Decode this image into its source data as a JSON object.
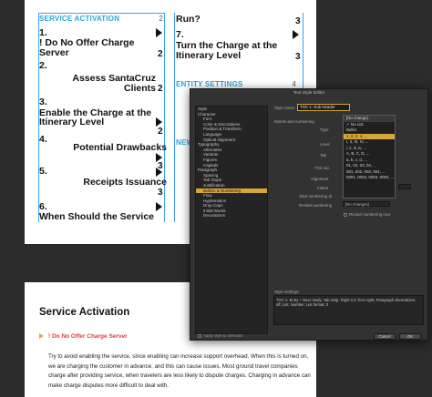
{
  "toc_left": {
    "heading": "SERVICE ACTIVATION",
    "heading_page": "2",
    "entries": [
      {
        "lines": [
          "1.",
          "! Do No Offer Charge",
          "Server"
        ],
        "page": "2"
      },
      {
        "lines": [
          "2.",
          "Assess SantaCruz Clients"
        ],
        "page": "2"
      },
      {
        "lines": [
          "3.",
          "Enable the Charge at the",
          "Itinerary Level"
        ],
        "page": "2"
      },
      {
        "lines": [
          "4.",
          "Potential Drawbacks"
        ],
        "page": "3"
      },
      {
        "lines": [
          "5.",
          "Receipts Issuance"
        ],
        "page": "3"
      },
      {
        "lines": [
          "6.",
          "When Should the Service"
        ],
        "page": "3"
      }
    ]
  },
  "toc_right": {
    "entry_a": [
      "Run?"
    ],
    "entry_a_page": "3",
    "entry_b": [
      "7.",
      "Turn the Charge at the",
      "Itinerary Level"
    ],
    "entry_b_page": "3",
    "heading": "ENTITY SETTINGS",
    "heading_page": "4",
    "heading2_partial": "NEW"
  },
  "dialog": {
    "title": "Text Style Editor",
    "style_name_label": "Style name:",
    "style_name_value": "TOC 1: Sub Header",
    "section_label": "Bullets and numbering",
    "type_label": "Type",
    "level_label": "Level",
    "tab_label": "Tab",
    "first_indent_label": "First ind.",
    "alignment_label": "Alignment",
    "indent_label": "Indent",
    "start_numbering_label": "Start numbering at",
    "restart_numbering_label": "Restart numbering",
    "no_changes_label": "[No changes]",
    "restart_list_label": "Restart numbering now",
    "sidebar": [
      {
        "label": "Style",
        "level": 0
      },
      {
        "label": "Character",
        "level": 0
      },
      {
        "label": "Font",
        "level": 1
      },
      {
        "label": "Color & Decorations",
        "level": 1
      },
      {
        "label": "Position & Transform",
        "level": 1
      },
      {
        "label": "Language",
        "level": 1
      },
      {
        "label": "Optical Alignment",
        "level": 1
      },
      {
        "label": "Typography",
        "level": 0
      },
      {
        "label": "Alternates",
        "level": 1
      },
      {
        "label": "Variants",
        "level": 1
      },
      {
        "label": "Figures",
        "level": 1
      },
      {
        "label": "Capitals",
        "level": 1
      },
      {
        "label": "Paragraph",
        "level": 0
      },
      {
        "label": "Spacing",
        "level": 1
      },
      {
        "label": "Tab Stops",
        "level": 1
      },
      {
        "label": "Justification",
        "level": 1
      },
      {
        "label": "Bullets & Numbering",
        "level": 1,
        "selected": true
      },
      {
        "label": "Flow",
        "level": 1
      },
      {
        "label": "Hyphenation",
        "level": 1
      },
      {
        "label": "Drop Caps",
        "level": 1
      },
      {
        "label": "Initial Words",
        "level": 1
      },
      {
        "label": "Decorations",
        "level": 1
      }
    ],
    "list_options": [
      {
        "label": "[No change]"
      },
      {
        "label": "✓ No List"
      },
      {
        "label": "Bullet"
      },
      {
        "label": "1, 2, 3, 4, ...",
        "selected": true
      },
      {
        "label": "I, II, III, IV, ..."
      },
      {
        "label": "i, ii, iii, iv, ..."
      },
      {
        "label": "A, B, C, D, ..."
      },
      {
        "label": "a, b, c, d, ..."
      },
      {
        "label": "01, 02, 03, 04, ..."
      },
      {
        "label": "001, 002, 003, 004, ..."
      },
      {
        "label": "0001, 0002, 0003, 0004, ..."
      }
    ],
    "settings_label": "Style settings:",
    "settings_text": "TOC 1: Entry + Next: Body; Tab Stop: Right 0 in from right; Paragraph decorations: off; List: Number; List format: 0",
    "apply_label": "Apply style to selection",
    "cancel": "Cancel",
    "ok": "OK"
  },
  "page_bottom": {
    "title": "Service Activation",
    "subtitle": "! Do No Offer Charge Server",
    "body": "Try to avoid enabling the service, since enabling can increase support overhead. When this is turned on, we are charging the customer in advance, and this can cause issues. Most ground travel companies charge after providing service, when travelers are less likely to dispute charges. Charging in advance can make charge disputes more difficult to deal with."
  }
}
